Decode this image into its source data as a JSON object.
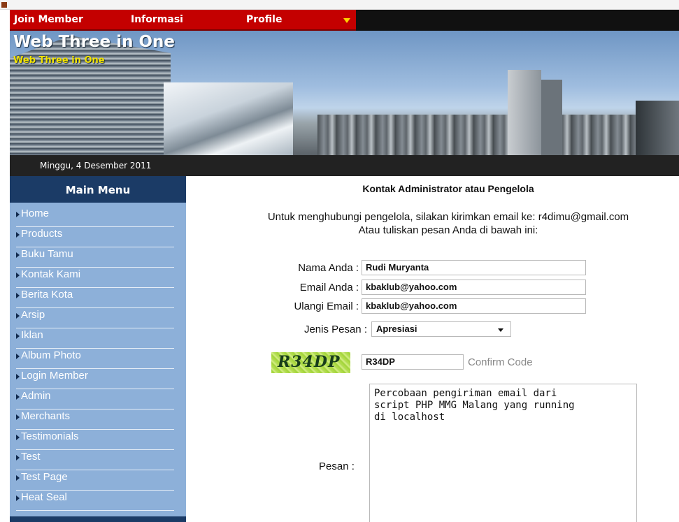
{
  "nav": {
    "items": [
      "Join Member",
      "Informasi",
      "Profile"
    ]
  },
  "header": {
    "title": "Web Three in One",
    "subtitle": "Web Three in One"
  },
  "datebar": {
    "date": "Minggu, 4 Desember 2011"
  },
  "sidebar": {
    "title": "Main Menu",
    "items": [
      "Home",
      "Products",
      "Buku Tamu",
      "Kontak Kami",
      "Berita Kota",
      "Arsip",
      "Iklan",
      "Album Photo",
      "Login Member",
      "Admin",
      "Merchants",
      "Testimonials",
      "Test",
      "Test Page",
      "Heat Seal"
    ]
  },
  "main": {
    "title": "Kontak Administrator atau Pengelola",
    "info_line1": "Untuk menghubungi pengelola, silakan kirimkan email ke: r4dimu@gmail.com",
    "info_line2": "Atau tuliskan pesan Anda di bawah ini:"
  },
  "form": {
    "nama_label": "Nama Anda :",
    "nama_value": "Rudi Muryanta",
    "email_label": "Email Anda :",
    "email_value": "kbaklub@yahoo.com",
    "ulangi_label": "Ulangi Email :",
    "ulangi_value": "kbaklub@yahoo.com",
    "jenis_label": "Jenis Pesan :",
    "jenis_value": "Apresiasi",
    "captcha_text": "R34DP",
    "confirm_value": "R34DP",
    "confirm_label": "Confirm Code",
    "pesan_label": "Pesan :",
    "pesan_value": "Percobaan pengiriman email dari\nscript PHP MMG Malang yang running\ndi localhost"
  },
  "colors": {
    "nav_red": "#c40000",
    "sidebar_bg": "#8db0d9",
    "sidebar_header": "#1b3b66",
    "subtitle_yellow": "#f4e400"
  }
}
